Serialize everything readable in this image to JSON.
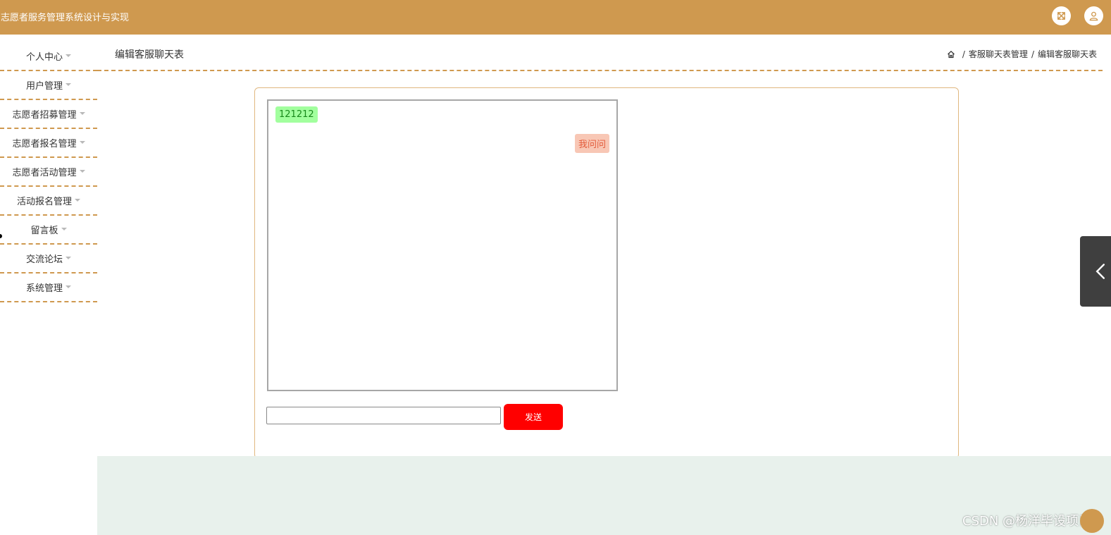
{
  "header": {
    "app_title": "志愿者服务管理系统设计与实现",
    "fullscreen_icon": "fullscreen-icon",
    "user_icon": "user-icon"
  },
  "sidebar": {
    "items": [
      {
        "label": "个人中心"
      },
      {
        "label": "用户管理"
      },
      {
        "label": "志愿者招募管理"
      },
      {
        "label": "志愿者报名管理"
      },
      {
        "label": "志愿者活动管理"
      },
      {
        "label": "活动报名管理"
      },
      {
        "label": "留言板"
      },
      {
        "label": "交流论坛"
      },
      {
        "label": "系统管理"
      }
    ]
  },
  "page": {
    "title": "编辑客服聊天表",
    "breadcrumb": [
      "客服聊天表管理",
      "编辑客服聊天表"
    ],
    "separator": "/"
  },
  "chat": {
    "messages": [
      {
        "side": "left",
        "text": "121212"
      },
      {
        "side": "right",
        "text": "我问问"
      }
    ],
    "input_value": "",
    "input_placeholder": "",
    "send_label": "发送"
  },
  "watermark": "CSDN @杨洋毕设项目",
  "colors": {
    "brand": "#cf994f",
    "send_button": "#ff0000",
    "bubble_left_bg": "#a2ff9e",
    "bubble_right_bg": "#f8c7b5",
    "footer_band": "#e8f1ec"
  }
}
